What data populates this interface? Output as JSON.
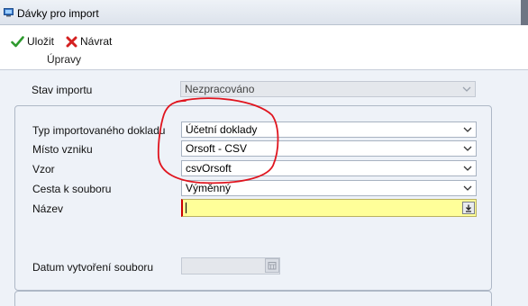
{
  "window": {
    "title": "Dávky pro import"
  },
  "toolbar": {
    "save_label": "Uložit",
    "back_label": "Návrat",
    "group_label": "Úpravy"
  },
  "form": {
    "stav_importu": {
      "label": "Stav importu",
      "value": "Nezpracováno"
    },
    "typ_dokladu": {
      "label": "Typ importovaného dokladu",
      "value": "Účetní doklady"
    },
    "misto_vzniku": {
      "label": "Místo vzniku",
      "value": "Orsoft - CSV"
    },
    "vzor": {
      "label": "Vzor",
      "value": "csvOrsoft"
    },
    "cesta_k_souboru": {
      "label": "Cesta k souboru",
      "value": "Výměnný"
    },
    "nazev": {
      "label": "Název",
      "value": ""
    },
    "datum_vytvoreni": {
      "label": "Datum vytvoření souboru",
      "value": ""
    }
  },
  "colors": {
    "accent_save": "#2e9a2e",
    "accent_back": "#d42020",
    "required_field_bg": "#ffff99",
    "annotation_red": "#e0141e"
  }
}
